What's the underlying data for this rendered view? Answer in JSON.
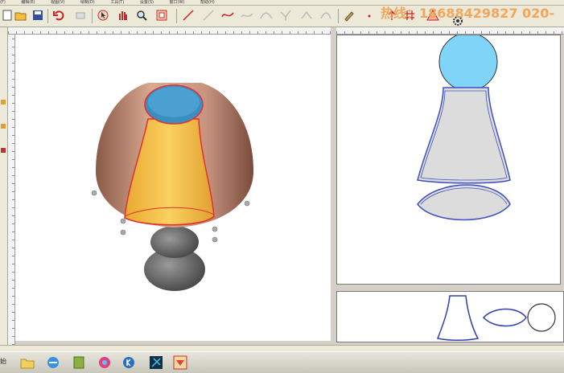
{
  "menu": {
    "items": [
      "(F)",
      "编辑(E)",
      "视图(V)",
      "绘制(D)",
      "工具(T)",
      "设置(S)",
      "窗口(W)",
      "帮助(H)"
    ]
  },
  "watermark": {
    "hotline": "热线：18688429827 020-"
  },
  "taskbar": {
    "start_label": "始"
  },
  "colors": {
    "accent_red": "#e03030",
    "cap_blue": "#3a8ec0",
    "shade_yellow": "#f2c040",
    "shade_copper": "#c08870",
    "base_gray": "#606060",
    "front_circle": "#7fd4f8",
    "front_outline": "#4050c0"
  },
  "icons": [
    "new-icon",
    "open-icon",
    "save-icon",
    "undo-icon",
    "redo-icon",
    "select-icon",
    "pan-icon",
    "zoom-icon",
    "zoom-extents-icon",
    "line-icon",
    "polyline-icon",
    "curve-icon",
    "wave-icon",
    "arc-icon",
    "control-point-icon",
    "pen-icon",
    "point-icon",
    "arrow-up-icon",
    "grid-icon",
    "warning-icon",
    "gear-icon"
  ]
}
